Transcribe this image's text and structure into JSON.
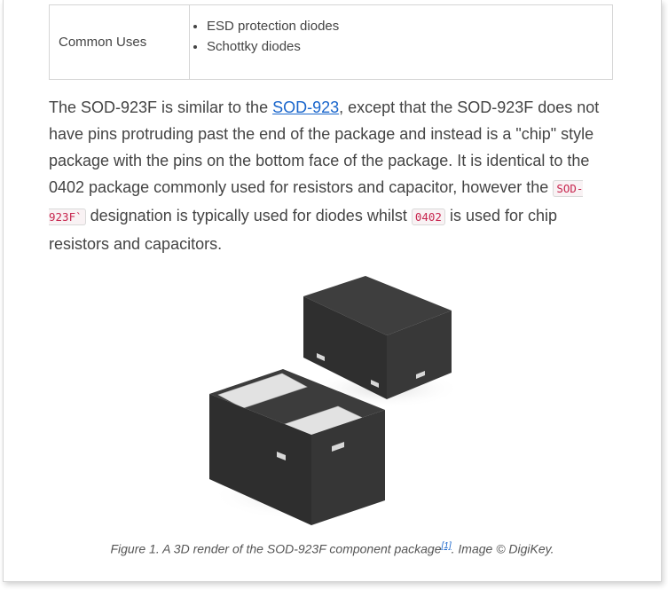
{
  "table": {
    "row_label": "Common Uses",
    "uses": [
      "ESD protection diodes",
      "Schottky diodes"
    ]
  },
  "paragraph": {
    "t1": "The SOD-923F is similar to the ",
    "link": "SOD-923",
    "t2": ", except that the SOD-923F does not have pins protruding past the end of the package and instead is a \"chip\" style package with the pins on the bottom face of the package. It is identical to the 0402 package commonly used for resistors and capacitor, however the ",
    "code1": "SOD-923F`",
    "t3": " designation is typically used for diodes whilst ",
    "code2": "0402",
    "t4": " is used for chip resistors and capacitors."
  },
  "figure": {
    "caption_prefix": "Figure 1. A 3D render of the SOD-923F component package",
    "ref": "[1]",
    "caption_suffix": ". Image © DigiKey."
  },
  "colors": {
    "link": "#1a66cc",
    "code_text": "#c7254e",
    "body_text": "#444444"
  }
}
